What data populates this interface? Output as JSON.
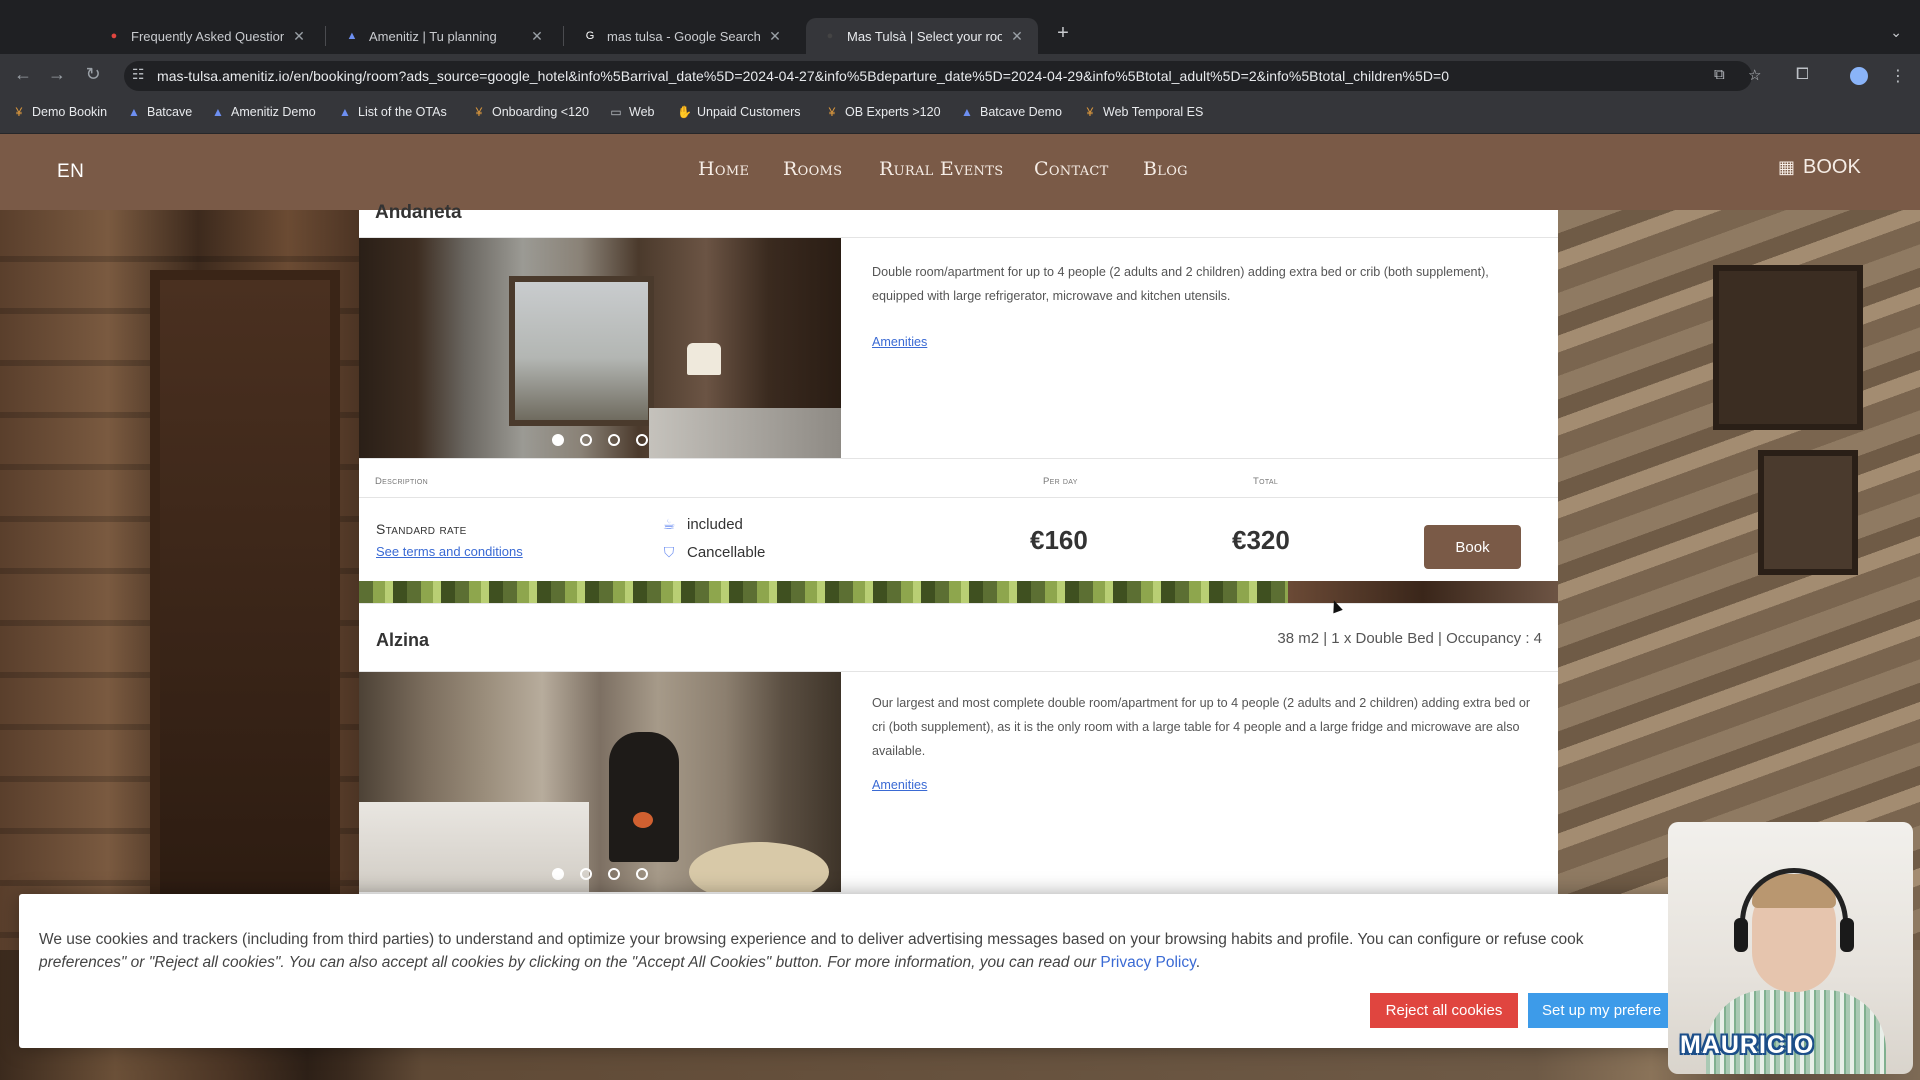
{
  "browser": {
    "tabs": [
      {
        "title": "Frequently Asked Questions",
        "icon": "faq-red-icon"
      },
      {
        "title": "Amenitiz | Tu planning",
        "icon": "amenitiz-icon"
      },
      {
        "title": "mas tulsa - Google Search",
        "icon": "google-icon"
      },
      {
        "title": "Mas Tulsà | Select your room",
        "icon": "site-icon",
        "active": true
      }
    ],
    "url": "mas-tulsa.amenitiz.io/en/booking/room?ads_source=google_hotel&info%5Barrival_date%5D=2024-04-27&info%5Bdeparture_date%5D=2024-04-29&info%5Btotal_adult%5D=2&info%5Btotal_children%5D=0",
    "bookmarks": [
      {
        "label": "Demo Bookin",
        "icon": "github-icon"
      },
      {
        "label": "Batcave",
        "icon": "amenitiz-icon"
      },
      {
        "label": "Amenitiz Demo",
        "icon": "amenitiz-icon"
      },
      {
        "label": "List of the OTAs",
        "icon": "amenitiz-icon"
      },
      {
        "label": "Onboarding <120",
        "icon": "github-icon"
      },
      {
        "label": "Web",
        "icon": "folder-icon"
      },
      {
        "label": "Unpaid Customers",
        "icon": "hand-icon"
      },
      {
        "label": "OB Experts >120",
        "icon": "github-icon"
      },
      {
        "label": "Batcave Demo",
        "icon": "amenitiz-icon"
      },
      {
        "label": "Web Temporal ES",
        "icon": "github-icon"
      }
    ]
  },
  "site": {
    "lang": "EN",
    "nav": [
      "Home",
      "Rooms",
      "Rural Events",
      "Contact",
      "Blog"
    ],
    "book_label": "BOOK",
    "accent": "#7a5a47",
    "room1": {
      "name_partial": "Andaneta",
      "description": "Double room/apartment for up to 4 people (2 adults and 2 children) adding extra bed or crib (both supplement), equipped with large refrigerator, microwave and kitchen utensils.",
      "amenities_label": "Amenities",
      "rates_header": {
        "description": "Description",
        "per_day": "Per day",
        "total": "Total"
      },
      "rate": {
        "name": "Standard rate",
        "terms": "See terms and conditions",
        "features": [
          "included",
          "Cancellable"
        ],
        "per_day": "€160",
        "total": "€320",
        "book": "Book"
      }
    },
    "room2": {
      "name": "Alzina",
      "meta": "38 m2 | 1 x Double Bed | Occupancy : 4",
      "description": "Our largest and most complete double room/apartment for up to 4 people (2 adults and 2 children) adding extra bed or cri (both supplement), as it is the only room with a large table for 4 people and a large fridge and microwave are also available.",
      "amenities_label": "Amenities"
    }
  },
  "cookie": {
    "text_1": "We use cookies and trackers (including from third parties) to understand and optimize your browsing experience and to deliver advertising messages based on your browsing habits and profile. You can configure or refuse cook",
    "text_2": "preferences\" or \"Reject all cookies\". You can also accept all cookies by clicking on the \"Accept All Cookies\" button. For more information, you can read our",
    "privacy": "Privacy Policy",
    "reject": "Reject all cookies",
    "setup": "Set up my prefere"
  },
  "webcam": {
    "name": "MAURICIO"
  }
}
